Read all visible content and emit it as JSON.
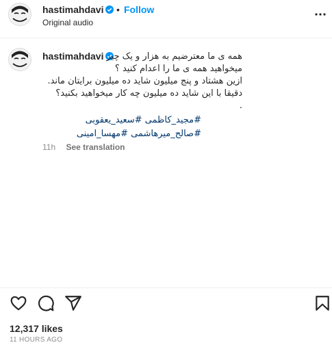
{
  "header": {
    "username": "hastimahdavi",
    "separator": "•",
    "follow_label": "Follow",
    "audio_label": "Original audio",
    "avatar_icon": "profile-avatar",
    "more_icon": "more-options-icon"
  },
  "caption": {
    "username": "hastimahdavi",
    "lines": [
      "همه ی ما معترضیم به هزار و یک چیز .",
      "میخواهید همه ی ما را اعدام کنید ؟",
      "ازین هشتاد و پنج میلیون شاید ده میلیون برایتان ماند. دقیقا با این شاید ده میلیون چه کار میخواهید بکنید؟",
      "."
    ],
    "hashtags": [
      "#مجید_کاظمی",
      "#سعید_یعقوبی",
      "#صالح_میرهاشمی",
      "#مهسا_امینی"
    ],
    "time": "11h",
    "see_translation": "See translation"
  },
  "actions": {
    "like_icon": "heart-icon",
    "comment_icon": "comment-icon",
    "share_icon": "share-icon",
    "save_icon": "bookmark-icon"
  },
  "stats": {
    "likes": "12,317 likes",
    "timestamp": "11 HOURS AGO"
  },
  "colors": {
    "accent": "#0095f6",
    "hashtag": "#00376b",
    "muted": "#8e8e8e",
    "verified": "#0095f6"
  }
}
